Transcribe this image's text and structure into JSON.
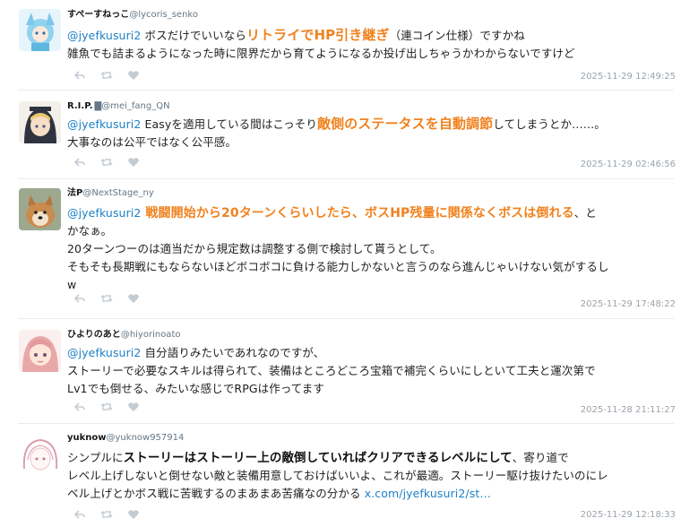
{
  "tweets": [
    {
      "name": "すぺーすねっこ",
      "handle": "@lycoris_senko",
      "mention": "@jyefkusuri2",
      "line1_pre": " ボスだけでいいなら",
      "line1_hl": "リトライでHP引き継ぎ",
      "line1_post": "（連コイン仕様）ですかね",
      "line2": "雑魚でも詰まるようになった時に限界だから育てようになるか投げ出しちゃうかわからないですけど",
      "time": "2025-11-29 12:49:25"
    },
    {
      "name": "R.I.P.",
      "handle": "@mei_fang_QN",
      "mention": "@jyefkusuri2",
      "line1_pre": " Easyを適用している間はこっそり",
      "line1_hl": "敵側のステータスを自動調節",
      "line1_post": "してしまうとか……。",
      "line2": "大事なのは公平ではなく公平感。",
      "time": "2025-11-29 02:46:56"
    },
    {
      "name": "法P",
      "handle": "@NextStage_ny",
      "mention": "@jyefkusuri2",
      "line1_hl": " 戦闘開始から20ターンくらいしたら、ボスHP残量に関係なくボスは倒れる",
      "line1_post": "、と",
      "line2": "かなぁ。",
      "line3": "20ターンつーのは適当だから規定数は調整する側で検討して貰うとして。",
      "line4": "そもそも長期戦にもならないほどボコボコに負ける能力しかないと言うのなら進んじゃいけない気がするし",
      "line5": "w",
      "time": "2025-11-29 17:48:22"
    },
    {
      "name": "ひよりのあと",
      "handle": "@hiyorinoato",
      "mention": "@jyefkusuri2",
      "line1_post": " 自分語りみたいであれなのですが、",
      "line2": "ストーリーで必要なスキルは得られて、装備はところどころ宝箱で補完くらいにしといて工夫と運次第で",
      "line3": "Lv1でも倒せる、みたいな感じでRPGは作ってます",
      "time": "2025-11-28 21:11:27"
    },
    {
      "name": "yuknow",
      "handle": "@yuknow957914",
      "line1_pre": "シンプルに",
      "line1_bold": "ストーリーはストーリー上の敵倒していればクリアできるレベルにして",
      "line1_post": "、寄り道で",
      "line2": "レベル上げしないと倒せない敵と装備用意しておけばいいよ、これが最適。ストーリー駆け抜けたいのにレ",
      "line3_pre": "ベル上げとかボス戦に苦戦するのまあまあ苦痛なの分かる ",
      "line3_link": "x.com/jyefkusuri2/st…",
      "time": "2025-11-29 12:18:33"
    }
  ],
  "icons": [
    "reply-icon",
    "retweet-icon",
    "like-icon"
  ],
  "colors": {
    "mention": "#1d81c6",
    "highlight": "#f0821e",
    "timestamp": "#9aa3ab"
  }
}
